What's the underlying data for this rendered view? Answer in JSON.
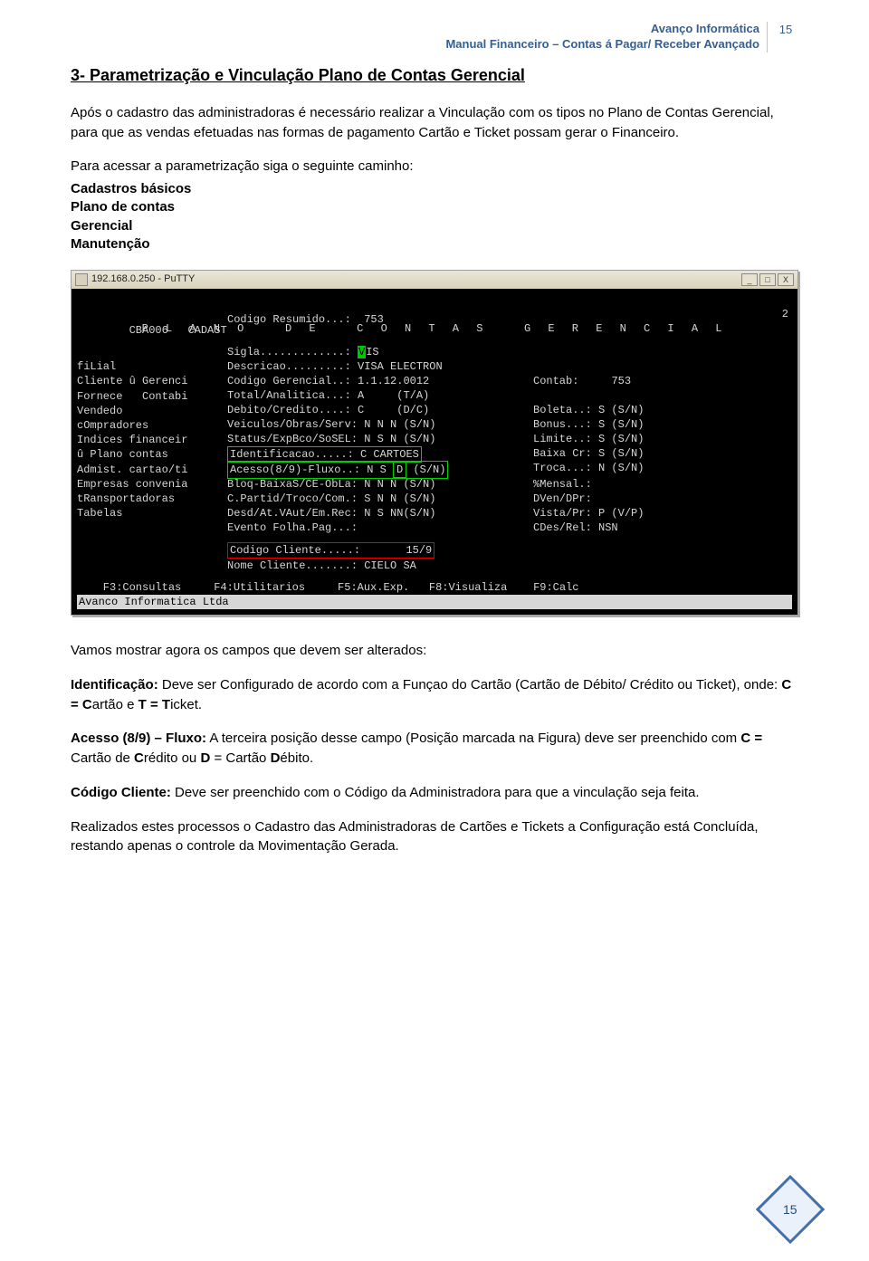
{
  "header": {
    "brand": "Avanço Informática",
    "doc_title": "Manual Financeiro – Contas á Pagar/ Receber Avançado",
    "page_number": "15"
  },
  "section": {
    "title": "3-  Parametrização e Vinculação Plano de Contas Gerencial",
    "p1": "Após o cadastro das administradoras é necessário realizar a Vinculação com os tipos no Plano de Contas Gerencial, para que as vendas efetuadas nas formas de pagamento Cartão e Ticket possam gerar o Financeiro.",
    "p2": "Para acessar a parametrização siga o seguinte caminho:",
    "path": [
      "Cadastros básicos",
      "Plano de contas",
      "Gerencial",
      "Manutenção"
    ]
  },
  "terminal": {
    "window_title": "192.168.0.250 - PuTTY",
    "window_buttons": {
      "min": "_",
      "max": "□",
      "close": "X"
    },
    "screen_title": "P L A N O   D E   C O N T A S   G E R E N C I A L",
    "page_num": "2",
    "left_header": "CBA006",
    "left_header2": "CADAST",
    "left_menu": [
      "fiLial",
      "Cliente û Gerenci",
      "Fornece   Contabi",
      "Vendedo",
      "cOmpradores",
      "Indices financeir",
      "û Plano contas",
      "Admist. cartao/ti",
      "Empresas convenia",
      "tRansportadoras",
      "Tabelas"
    ],
    "fields": {
      "codigo_resumido": {
        "label": "Codigo Resumido...:",
        "value": "753"
      },
      "sigla": {
        "label": "Sigla.............:",
        "value": "VIS",
        "hi_first": "V"
      },
      "descricao": {
        "label": "Descricao.........:",
        "value": "VISA ELECTRON"
      },
      "cod_ger": {
        "label": "Codigo Gerencial..:",
        "value": "1.1.12.0012",
        "extra_label": "Contab:",
        "extra_value": "753"
      },
      "total_anal": {
        "label": "Total/Analitica...:",
        "value": "A",
        "note": "(T/A)"
      },
      "deb_cred": {
        "label": "Debito/Credito....:",
        "value": "C",
        "note": "(D/C)"
      },
      "veic": {
        "label": "Veiculos/Obras/Serv:",
        "value": "N N N",
        "note": "(S/N)"
      },
      "status": {
        "label": "Status/ExpBco/SoSEL:",
        "value": "N S N",
        "note": "(S/N)"
      },
      "ident": {
        "label": "Identificacao.....:",
        "value": "C CARTOES"
      },
      "acesso": {
        "label": "Acesso(8/9)-Fluxo..:",
        "value_a": "N S ",
        "value_hi": "D",
        "note": "(S/N)"
      },
      "bloq": {
        "label": "Bloq-BaixaS/CE-ObLa:",
        "value": "N N N",
        "note": "(S/N)"
      },
      "cpart": {
        "label": "C.Partid/Troco/Com.:",
        "value": "S N N",
        "note": "(S/N)"
      },
      "desd": {
        "label": "Desd/At.VAut/Em.Rec:",
        "value": "N S NN(S/N)"
      },
      "evento": {
        "label": "Evento Folha.Pag...:"
      },
      "cod_cli": {
        "label": "Codigo Cliente.....:",
        "value": "15/9"
      },
      "nome_cli": {
        "label": "Nome Cliente.......:",
        "value": "CIELO SA"
      }
    },
    "rights": {
      "boleta": {
        "label": "Boleta..:",
        "value": "S",
        "note": "(S/N)"
      },
      "bonus": {
        "label": "Bonus...:",
        "value": "S",
        "note": "(S/N)"
      },
      "limite": {
        "label": "Limite..:",
        "value": "S",
        "note": "(S/N)"
      },
      "baixacr": {
        "label": "Baixa Cr:",
        "value": "S",
        "note": "(S/N)"
      },
      "troca": {
        "label": "Troca...:",
        "value": "N",
        "note": "(S/N)"
      },
      "mensal": {
        "label": "%Mensal.:"
      },
      "dven": {
        "label": "DVen/DPr:"
      },
      "vista": {
        "label": "Vista/Pr:",
        "value": "P",
        "note": "(V/P)"
      },
      "cdes": {
        "label": "CDes/Rel:",
        "value": "NSN"
      }
    },
    "fkeys": "    F3:Consultas     F4:Utilitarios     F5:Aux.Exp.   F8:Visualiza    F9:Calc",
    "footer_status": "Avanco Informatica Ltda"
  },
  "explain": {
    "intro": "Vamos mostrar agora os campos que devem ser alterados:",
    "ident_label": "Identificação:",
    "ident_text": " Deve ser Configurado de acordo com a Funçao do Cartão (Cartão de Débito/ Crédito ou Ticket), onde:  ",
    "ident_codes_bold1": "C = C",
    "ident_codes_txt1": "artão e ",
    "ident_codes_bold2": "T = T",
    "ident_codes_txt2": "icket.",
    "acesso_label": "Acesso (8/9) – Fluxo:",
    "acesso_text1": " A terceira posição desse campo (Posição marcada na Figura) deve ser preenchido com ",
    "acesso_b1": "C = ",
    "acesso_t1": "Cartão de ",
    "acesso_b2": "C",
    "acesso_t2": "rédito ou  ",
    "acesso_b3": "D",
    "acesso_t3": " = Cartão ",
    "acesso_b4": "D",
    "acesso_t4": "ébito.",
    "codcli_label": "Código Cliente:",
    "codcli_text": " Deve ser preenchido com o Código da Administradora  para que a vinculação seja feita.",
    "final": "Realizados estes processos o Cadastro das Administradoras de Cartões e Tickets a Configuração está Concluída, restando apenas o controle da Movimentação Gerada."
  },
  "footer_badge": "15"
}
